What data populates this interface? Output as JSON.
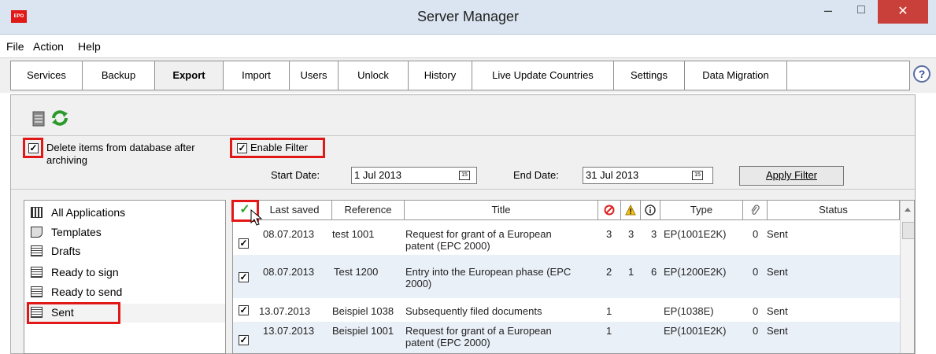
{
  "window": {
    "title": "Server Manager",
    "app_icon": "EPO",
    "close": "✕",
    "minimize": "–",
    "maximize": "□"
  },
  "menu": [
    "File",
    "Action",
    "Help"
  ],
  "tabs": [
    "Services",
    "Backup",
    "Export",
    "Import",
    "Users",
    "Unlock",
    "History",
    "Live Update Countries",
    "Settings",
    "Data Migration"
  ],
  "active_tab": "Export",
  "help": "?",
  "toolbar": {
    "archive_icon": "database-icon",
    "refresh_icon": "refresh-icon"
  },
  "options": {
    "delete_label": "Delete items from database after archiving",
    "delete_checked": "✓",
    "filter_label": "Enable Filter",
    "filter_checked": "✓"
  },
  "filter": {
    "start_label": "Start Date:",
    "start_value": "1 Jul 2013",
    "end_label": "End Date:",
    "end_value": "31 Jul 2013",
    "apply_label": "Apply Filter",
    "cal_glyph": "15"
  },
  "folders": [
    {
      "label": "All Applications",
      "icon": "all-applications-icon"
    },
    {
      "label": "Templates",
      "icon": "templates-icon"
    },
    {
      "label": "Drafts",
      "icon": "drafts-icon"
    },
    {
      "label": "Ready to sign",
      "icon": "ready-to-sign-icon"
    },
    {
      "label": "Ready to send",
      "icon": "ready-to-send-icon"
    },
    {
      "label": "Sent",
      "icon": "sent-icon"
    }
  ],
  "columns": {
    "check": "✓",
    "last_saved": "Last saved",
    "reference": "Reference",
    "title": "Title",
    "errors_icon": "error-icon",
    "warnings_icon": "warning-icon",
    "info_icon": "info-icon",
    "type": "Type",
    "attach_icon": "paperclip-icon",
    "status": "Status"
  },
  "rows": [
    {
      "check": "✓",
      "date": "08.07.2013",
      "ref": "test 1001",
      "title1": "Request for grant of a European",
      "title2": "patent (EPC 2000)",
      "err": "3",
      "warn": "3",
      "info": "3",
      "type": "EP(1001E2K)",
      "att": "0",
      "status": "Sent"
    },
    {
      "check": "✓",
      "date": "08.07.2013",
      "ref": "Test 1200",
      "title1": "Entry into the European phase (EPC",
      "title2": "2000)",
      "err": "2",
      "warn": "1",
      "info": "6",
      "type": "EP(1200E2K)",
      "att": "0",
      "status": "Sent"
    },
    {
      "check": "✓",
      "date": "13.07.2013",
      "ref": "Beispiel 1038",
      "title1": "Subsequently filed documents",
      "title2": "",
      "err": "1",
      "warn": "",
      "info": "",
      "type": "EP(1038E)",
      "att": "0",
      "status": "Sent"
    },
    {
      "check": "✓",
      "date": "13.07.2013",
      "ref": "Beispiel 1001",
      "title1": "Request for grant of a European",
      "title2": "patent (EPC 2000)",
      "err": "1",
      "warn": "",
      "info": "",
      "type": "EP(1001E2K)",
      "att": "0",
      "status": "Sent"
    }
  ]
}
